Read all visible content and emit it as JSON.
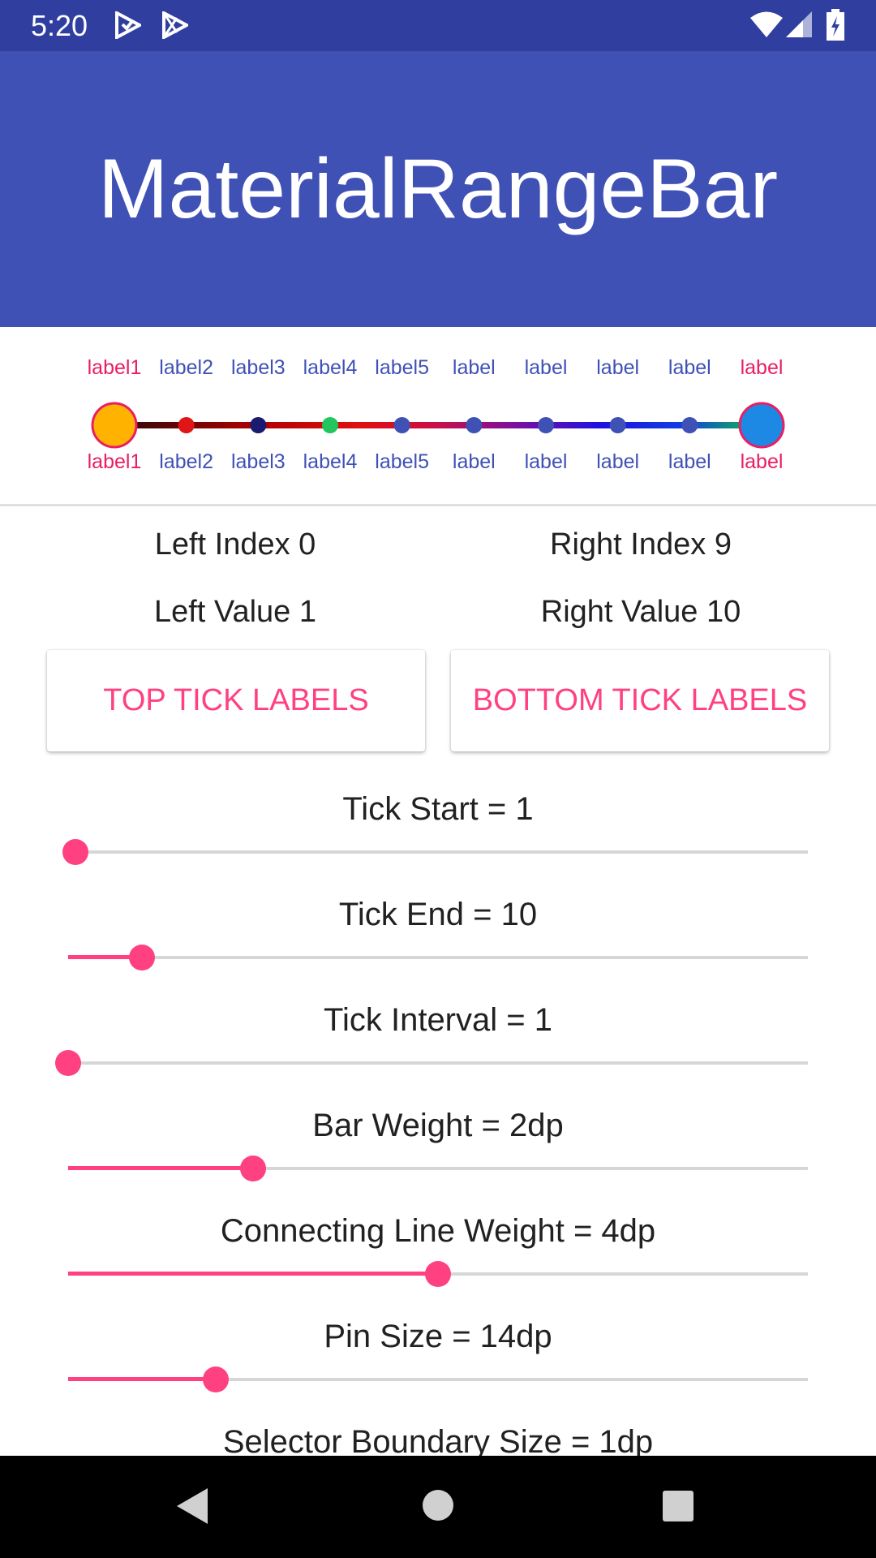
{
  "status_bar": {
    "time": "5:20",
    "icons": [
      "play-protect-icon",
      "play-store-icon",
      "wifi-icon",
      "cell-signal-icon",
      "battery-charging-icon"
    ]
  },
  "app": {
    "title": "MaterialRangeBar"
  },
  "range_bar": {
    "top_labels": [
      "label1",
      "label2",
      "label3",
      "label4",
      "label5",
      "label",
      "label",
      "label",
      "label",
      "label"
    ],
    "bottom_labels": [
      "label1",
      "label2",
      "label3",
      "label4",
      "label5",
      "label",
      "label",
      "label",
      "label",
      "label"
    ],
    "tick_colors": [
      "#FFB300",
      "#E01515",
      "#1A1A6E",
      "#22C55E",
      "#3F51B5",
      "#3F51B5",
      "#3F51B5",
      "#3F51B5",
      "#3F51B5",
      "#1E88E5"
    ],
    "left_thumb_color": "#FFB300",
    "right_thumb_color": "#1E88E5",
    "thumb_border_color": "#E91E63",
    "label_color": "#3F51B5",
    "selected_label_color": "#E91E63",
    "left_index": 0,
    "right_index": 9
  },
  "info": {
    "left_index": "Left Index 0",
    "right_index": "Right Index 9",
    "left_value": "Left Value 1",
    "right_value": "Right Value 10"
  },
  "buttons": {
    "top_tick_labels": "TOP TICK LABELS",
    "bottom_tick_labels": "BOTTOM TICK LABELS"
  },
  "controls": [
    {
      "label": "Tick Start = 1",
      "level": 0.01
    },
    {
      "label": "Tick End = 10",
      "level": 0.1
    },
    {
      "label": "Tick Interval = 1",
      "level": 0.0
    },
    {
      "label": "Bar Weight = 2dp",
      "level": 0.25
    },
    {
      "label": "Connecting Line Weight = 4dp",
      "level": 0.5
    },
    {
      "label": "Pin Size = 14dp",
      "level": 0.2
    },
    {
      "label": "Selector Boundary Size = 1dp"
    }
  ],
  "colors": {
    "primary": "#3F51B5",
    "primary_dark": "#303F9F",
    "accent": "#FF4081"
  },
  "nav_bar": {
    "icons": [
      "back-icon",
      "home-icon",
      "recents-icon"
    ]
  }
}
